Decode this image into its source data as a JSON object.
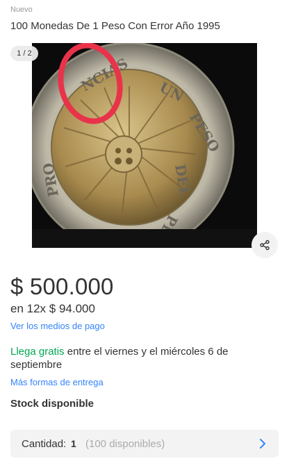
{
  "item": {
    "condition": "Nuevo",
    "title": "100 Monedas De 1 Peso Con Error Año 1995"
  },
  "gallery": {
    "counter": "1 / 2",
    "share_icon": "share-icon"
  },
  "pricing": {
    "price": "$ 500.000",
    "installments": "en 12x $ 94.000",
    "payment_link": "Ver los medios de pago"
  },
  "shipping": {
    "free_label": "Llega gratis",
    "window": " entre el viernes y el miércoles 6 de septiembre",
    "more_link": "Más formas de entrega"
  },
  "stock": {
    "label": "Stock disponible"
  },
  "quantity": {
    "label": "Cantidad:",
    "value": "1",
    "available": "(100 disponibles)",
    "chevron_icon": "chevron-right-icon"
  },
  "colors": {
    "link": "#3483fa",
    "free_shipping": "#00a650",
    "annotation_circle": "#e8334a"
  }
}
